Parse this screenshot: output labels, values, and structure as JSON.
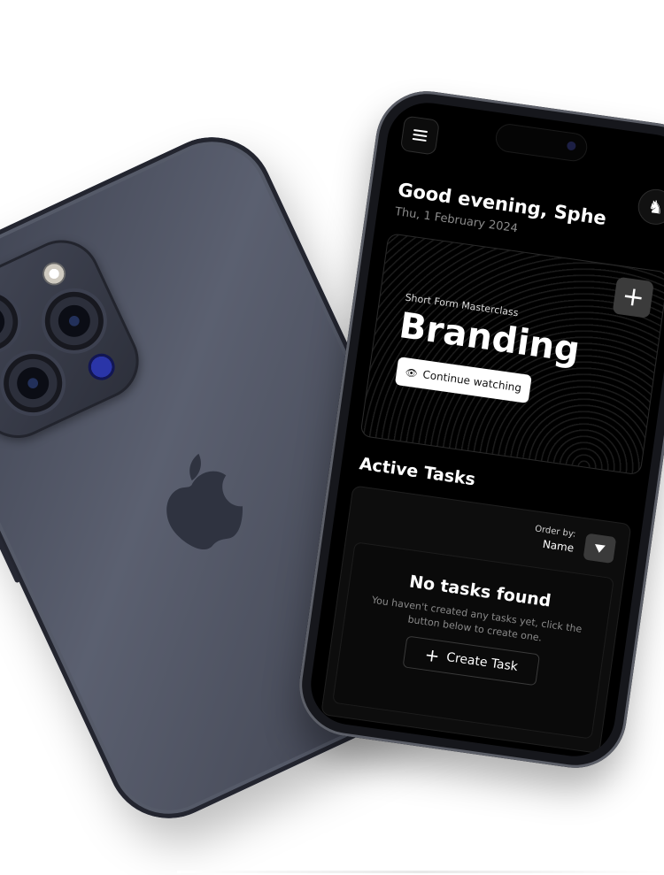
{
  "header": {
    "greeting": "Good evening, Sphe",
    "date": "Thu, 1 February 2024"
  },
  "hero": {
    "subtitle": "Short Form Masterclass",
    "title": "Branding",
    "continue_label": "Continue watching",
    "add_label": "+"
  },
  "tasks": {
    "section_title": "Active Tasks",
    "order_label": "Order by:",
    "order_value": "Name",
    "empty_title": "No tasks found",
    "empty_text": "You haven't created any tasks yet, click the button below to create one.",
    "create_label": "Create Task"
  },
  "icons": {
    "menu": "hamburger-menu-icon",
    "avatar": "chess-knight-icon",
    "eye": "eye-icon",
    "plus": "plus-icon",
    "dropdown": "triangle-down-icon",
    "apple": "apple-logo-icon"
  },
  "colors": {
    "screen_bg": "#000000",
    "phone_back": "#4f5363",
    "accent_blue": "#2a35a8",
    "button_light": "#ffffff",
    "button_dark": "#3a3a3a"
  }
}
